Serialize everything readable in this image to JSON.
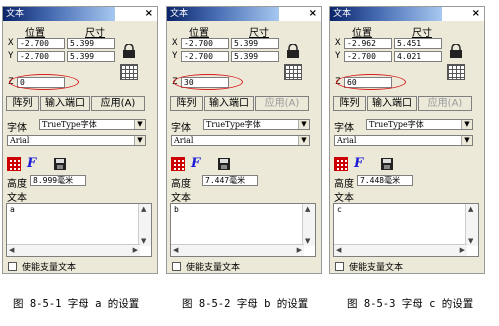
{
  "panels": [
    {
      "title": "文本",
      "close": "×",
      "headers": {
        "position": "位置",
        "size": "尺寸"
      },
      "rows": [
        {
          "label": "X",
          "pos": "-2.700",
          "size": "5.399"
        },
        {
          "label": "Y",
          "pos": "-2.700",
          "size": "5.399"
        }
      ],
      "z": {
        "label": "Z",
        "value": "0"
      },
      "buttons": {
        "array": "阵列",
        "port": "输入端口",
        "apply": "应用(A)"
      },
      "apply_disabled": false,
      "font": {
        "label": "字体",
        "type": "TrueType字体",
        "name": "Arial"
      },
      "height": {
        "label": "高度",
        "value": "8.999毫米"
      },
      "text": {
        "label": "文本",
        "value": "a"
      },
      "vector_label": "使能支量文本"
    },
    {
      "title": "文本",
      "close": "×",
      "headers": {
        "position": "位置",
        "size": "尺寸"
      },
      "rows": [
        {
          "label": "X",
          "pos": "-2.700",
          "size": "5.399"
        },
        {
          "label": "Y",
          "pos": "-2.700",
          "size": "5.399"
        }
      ],
      "z": {
        "label": "Z",
        "value": "30"
      },
      "buttons": {
        "array": "阵列",
        "port": "输入端口",
        "apply": "应用(A)"
      },
      "apply_disabled": true,
      "font": {
        "label": "字体",
        "type": "TrueType字体",
        "name": "Arial"
      },
      "height": {
        "label": "高度",
        "value": "7.447毫米"
      },
      "text": {
        "label": "文本",
        "value": "b"
      },
      "vector_label": "使能支量文本"
    },
    {
      "title": "文本",
      "close": "×",
      "headers": {
        "position": "位置",
        "size": "尺寸"
      },
      "rows": [
        {
          "label": "X",
          "pos": "-2.962",
          "size": "5.451"
        },
        {
          "label": "Y",
          "pos": "-2.700",
          "size": "4.021"
        }
      ],
      "z": {
        "label": "Z",
        "value": "60"
      },
      "buttons": {
        "array": "阵列",
        "port": "输入端口",
        "apply": "应用(A)"
      },
      "apply_disabled": true,
      "font": {
        "label": "字体",
        "type": "TrueType字体",
        "name": "Arial"
      },
      "height": {
        "label": "高度",
        "value": "7.448毫米"
      },
      "text": {
        "label": "文本",
        "value": "c"
      },
      "vector_label": "使能支量文本"
    }
  ],
  "captions": [
    "图 8-5-1 字母 a 的设置",
    "图 8-5-2 字母 b 的设置",
    "图 8-5-3 字母 c 的设置"
  ],
  "colors": {
    "highlight_ellipse": "#d81e1e",
    "title_bar": "#0a246a",
    "italic_f": "#1a1ad8"
  }
}
